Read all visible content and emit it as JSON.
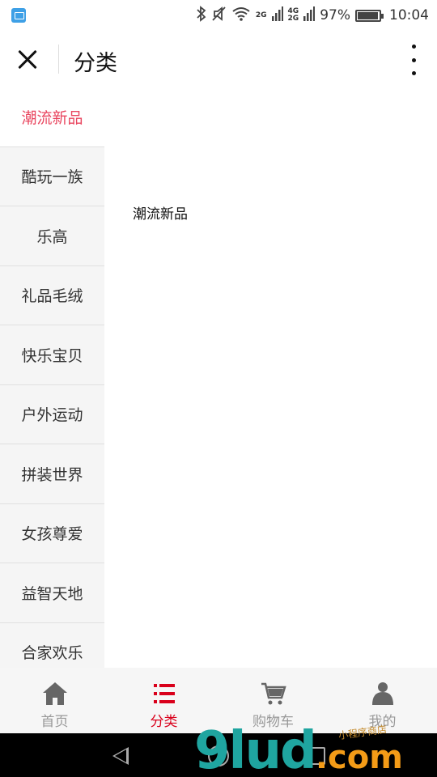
{
  "status_bar": {
    "network_top": "4G",
    "network_bottom": "2G",
    "signal_label": "2G",
    "battery": "97%",
    "time": "10:04"
  },
  "header": {
    "title": "分类"
  },
  "sidebar": {
    "items": [
      {
        "label": "潮流新品",
        "active": true
      },
      {
        "label": "酷玩一族"
      },
      {
        "label": "乐高"
      },
      {
        "label": "礼品毛绒"
      },
      {
        "label": "快乐宝贝"
      },
      {
        "label": "户外运动"
      },
      {
        "label": "拼装世界"
      },
      {
        "label": "女孩尊爱"
      },
      {
        "label": "益智天地"
      },
      {
        "label": "合家欢乐"
      }
    ]
  },
  "content": {
    "category_title": "潮流新品"
  },
  "tabbar": {
    "tabs": [
      {
        "label": "首页",
        "icon": "home-icon"
      },
      {
        "label": "分类",
        "icon": "list-icon",
        "active": true
      },
      {
        "label": "购物车",
        "icon": "cart-icon"
      },
      {
        "label": "我的",
        "icon": "user-icon"
      }
    ]
  },
  "watermark": {
    "digits": "9lud",
    "suffix": ".com",
    "tagline": "小程序商店"
  },
  "colors": {
    "accent": "#e9465f",
    "tab_active": "#d9001b",
    "sidebar_bg": "#f5f5f5"
  }
}
